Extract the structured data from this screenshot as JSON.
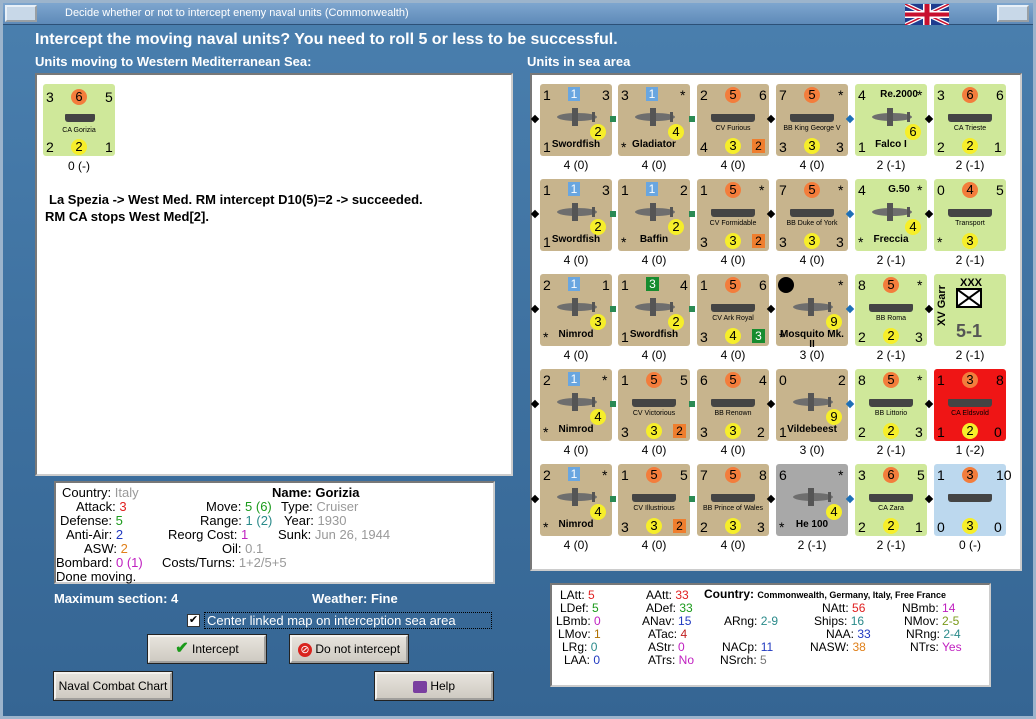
{
  "window": {
    "title": "Decide whether or not to intercept enemy naval units (Commonwealth)"
  },
  "heading": "Intercept the moving naval units?  You need to roll 5 or less to be successful.",
  "left_label": "Units moving to Western Mediterranean Sea:",
  "right_label": "Units in sea area",
  "moving_unit": {
    "tl": "3",
    "tc": "6",
    "tr": "5",
    "name": "CA Gorizia",
    "bl": "2",
    "bc": "2",
    "br": "1",
    "under": "0 (-)"
  },
  "log": {
    "line1": "La Spezia -> West Med.  RM intercept D10(5)=2 -> succeeded.",
    "line2": "RM CA stops West Med[2]."
  },
  "sea_units": [
    [
      {
        "tl": "1",
        "tc": "1",
        "tr": "3",
        "name": "Swordfish",
        "bc": "2",
        "bl": "1",
        "br": "",
        "under": "4 (0)",
        "kind": "plane"
      },
      {
        "tl": "3",
        "tc": "1",
        "tr": "*",
        "name": "Gladiator",
        "bc": "4",
        "bl": "*",
        "br": "",
        "under": "4 (0)",
        "kind": "plane"
      },
      {
        "tl": "2",
        "tc": "5",
        "tr": "6",
        "name": "CV Furious",
        "bc": "3",
        "bl": "4",
        "br": "2",
        "under": "4 (0)",
        "kind": "ship"
      },
      {
        "tl": "7",
        "tc": "5",
        "tr": "*",
        "name": "BB King George V",
        "bc": "3",
        "bl": "3",
        "br": "3",
        "under": "4 (0)",
        "kind": "ship"
      },
      {
        "tl": "4",
        "tc": "",
        "tr": "*",
        "name": "Falco I",
        "title2": "Re.2000",
        "bc": "6",
        "bl": "1",
        "br": "",
        "under": "2 (-1)",
        "kind": "plane"
      },
      {
        "tl": "3",
        "tc": "6",
        "tr": "6",
        "name": "CA Trieste",
        "bc": "2",
        "bl": "2",
        "br": "1",
        "under": "2 (-1)",
        "kind": "ship"
      }
    ],
    [
      {
        "tl": "1",
        "tc": "1",
        "tr": "3",
        "name": "Swordfish",
        "bc": "2",
        "bl": "1",
        "br": "",
        "under": "4 (0)",
        "kind": "plane"
      },
      {
        "tl": "1",
        "tc": "1",
        "tr": "2",
        "name": "Baffin",
        "bc": "2",
        "bl": "*",
        "br": "",
        "under": "4 (0)",
        "kind": "plane"
      },
      {
        "tl": "1",
        "tc": "5",
        "tr": "*",
        "name": "CV Formidable",
        "bc": "3",
        "bl": "3",
        "br": "2",
        "under": "4 (0)",
        "kind": "ship"
      },
      {
        "tl": "7",
        "tc": "5",
        "tr": "*",
        "name": "BB Duke of York",
        "bc": "3",
        "bl": "3",
        "br": "3",
        "under": "4 (0)",
        "kind": "ship"
      },
      {
        "tl": "4",
        "tc": "",
        "tr": "*",
        "name": "Freccia",
        "title2": "G.50",
        "bc": "4",
        "bl": "*",
        "br": "",
        "under": "2 (-1)",
        "kind": "plane"
      },
      {
        "tl": "0",
        "tc": "4",
        "tr": "5",
        "name": "Transport",
        "bc": "3",
        "bl": "*",
        "br": "",
        "under": "2 (-1)",
        "kind": "ship"
      }
    ],
    [
      {
        "tl": "2",
        "tc": "1",
        "tr": "1",
        "name": "Nimrod",
        "bc": "3",
        "bl": "*",
        "br": "",
        "under": "4 (0)",
        "kind": "plane"
      },
      {
        "tl": "1",
        "tc": "3",
        "tr": "4",
        "name": "Swordfish",
        "bc": "2",
        "bl": "1",
        "br": "",
        "under": "4 (0)",
        "kind": "plane"
      },
      {
        "tl": "1",
        "tc": "5",
        "tr": "6",
        "name": "CV Ark Royal",
        "bc": "4",
        "bl": "3",
        "br": "3",
        "under": "4 (0)",
        "kind": "ship"
      },
      {
        "tl": "6",
        "tc": "",
        "tr": "*",
        "name": "Mosquito Mk. II",
        "bc": "9",
        "bl": "*",
        "br": "",
        "under": "3 (0)",
        "kind": "plane"
      },
      {
        "tl": "8",
        "tc": "5",
        "tr": "*",
        "name": "BB Roma",
        "bc": "2",
        "bl": "2",
        "br": "3",
        "under": "2 (-1)",
        "kind": "ship"
      },
      {
        "tl": "XV Garr",
        "tc": "XXX",
        "tr": "",
        "name": "5-1",
        "bc": "",
        "bl": "",
        "br": "",
        "under": "2 (-1)",
        "kind": "garrison"
      }
    ],
    [
      {
        "tl": "2",
        "tc": "1",
        "tr": "*",
        "name": "Nimrod",
        "bc": "4",
        "bl": "*",
        "br": "",
        "under": "4 (0)",
        "kind": "plane"
      },
      {
        "tl": "1",
        "tc": "5",
        "tr": "5",
        "name": "CV Victorious",
        "bc": "3",
        "bl": "3",
        "br": "2",
        "under": "4 (0)",
        "kind": "ship"
      },
      {
        "tl": "6",
        "tc": "5",
        "tr": "4",
        "name": "BB Renown",
        "bc": "3",
        "bl": "3",
        "br": "2",
        "under": "4 (0)",
        "kind": "ship"
      },
      {
        "tl": "0",
        "tc": "",
        "tr": "2",
        "name": "Vildebeest",
        "bc": "9",
        "bl": "1",
        "br": "",
        "under": "3 (0)",
        "kind": "plane"
      },
      {
        "tl": "8",
        "tc": "5",
        "tr": "*",
        "name": "BB Littorio",
        "bc": "2",
        "bl": "2",
        "br": "3",
        "under": "2 (-1)",
        "kind": "ship"
      },
      {
        "tl": "1",
        "tc": "3",
        "tr": "8",
        "name": "CA Eldsvold",
        "bc": "2",
        "bl": "1",
        "br": "0",
        "under": "1 (-2)",
        "kind": "ship"
      }
    ],
    [
      {
        "tl": "2",
        "tc": "1",
        "tr": "*",
        "name": "Nimrod",
        "bc": "4",
        "bl": "*",
        "br": "",
        "under": "4 (0)",
        "kind": "plane"
      },
      {
        "tl": "1",
        "tc": "5",
        "tr": "5",
        "name": "CV Illustrious",
        "bc": "3",
        "bl": "3",
        "br": "2",
        "under": "4 (0)",
        "kind": "ship"
      },
      {
        "tl": "7",
        "tc": "5",
        "tr": "8",
        "name": "BB Prince of Wales",
        "bc": "3",
        "bl": "2",
        "br": "3",
        "under": "4 (0)",
        "kind": "ship"
      },
      {
        "tl": "6",
        "tc": "",
        "tr": "*",
        "name": "He 100",
        "bc": "4",
        "bl": "*",
        "br": "",
        "under": "2 (-1)",
        "kind": "plane"
      },
      {
        "tl": "3",
        "tc": "6",
        "tr": "5",
        "name": "CA Zara",
        "bc": "2",
        "bl": "2",
        "br": "1",
        "under": "2 (-1)",
        "kind": "ship"
      },
      {
        "tl": "1",
        "tc": "3",
        "tr": "10",
        "name": "",
        "bc": "3",
        "bl": "0",
        "br": "0",
        "under": "0 (-)",
        "kind": "ship"
      }
    ]
  ],
  "info": {
    "country_l": "Country:",
    "country_v": "Italy",
    "attack_l": "Attack:",
    "attack_v": "3",
    "defense_l": "Defense:",
    "defense_v": "5",
    "aa_l": "Anti-Air:",
    "aa_v": "2",
    "asw_l": "ASW:",
    "asw_v": "2",
    "bomb_l": "Bombard:",
    "bomb_v": "0 (1)",
    "done": "Done moving.",
    "name_l": "Name:",
    "name_v": "Gorizia",
    "move_l": "Move:",
    "move_v": "5 (6)",
    "type_l": "Type:",
    "type_v": "Cruiser",
    "range_l": "Range:",
    "range_v": "1 (2)",
    "year_l": "Year:",
    "year_v": "1930",
    "reorg_l": "Reorg Cost:",
    "reorg_v": "1",
    "sunk_l": "Sunk:",
    "sunk_v": "Jun 26, 1944",
    "oil_l": "Oil:",
    "oil_v": "0.1",
    "costs_l": "Costs/Turns:",
    "costs_v": "1+2/5+5"
  },
  "max_section": "Maximum section: 4",
  "weather": "Weather:  Fine",
  "checkbox_label": "Center linked map on interception sea area",
  "buttons": {
    "intercept": "Intercept",
    "not_intercept": "Do not intercept",
    "chart": "Naval Combat Chart",
    "help": "Help"
  },
  "stats": {
    "latt_l": "LAtt:",
    "latt_v": "5",
    "ldef_l": "LDef:",
    "ldef_v": "5",
    "lbmb_l": "LBmb:",
    "lbmb_v": "0",
    "lmov_l": "LMov:",
    "lmov_v": "1",
    "lrg_l": "LRg:",
    "lrg_v": "0",
    "laa_l": "LAA:",
    "laa_v": "0",
    "aatt_l": "AAtt:",
    "aatt_v": "33",
    "adef_l": "ADef:",
    "adef_v": "33",
    "anav_l": "ANav:",
    "anav_v": "15",
    "arng_l": "ARng:",
    "arng_v": "2-9",
    "atac_l": "ATac:",
    "atac_v": "4",
    "astr_l": "AStr:",
    "astr_v": "0",
    "atrs_l": "ATrs:",
    "atrs_v": "No",
    "country_l": "Country:",
    "country_v": "Commonwealth, Germany, Italy, Free France",
    "natt_l": "NAtt:",
    "natt_v": "56",
    "ships_l": "Ships:",
    "ships_v": "16",
    "naa_l": "NAA:",
    "naa_v": "33",
    "nasw_l": "NASW:",
    "nasw_v": "38",
    "nacp_l": "NACp:",
    "nacp_v": "11",
    "nsrch_l": "NSrch:",
    "nsrch_v": "5",
    "nbmb_l": "NBmb:",
    "nbmb_v": "14",
    "nmov_l": "NMov:",
    "nmov_v": "2-5",
    "nrng_l": "NRng:",
    "nrng_v": "2-4",
    "ntrs_l": "NTrs:",
    "ntrs_v": "Yes"
  },
  "colors": {
    "bg": "#3e71a0",
    "tan": "#c7b48d",
    "green": "#cfe89a",
    "red": "#ef1515"
  }
}
